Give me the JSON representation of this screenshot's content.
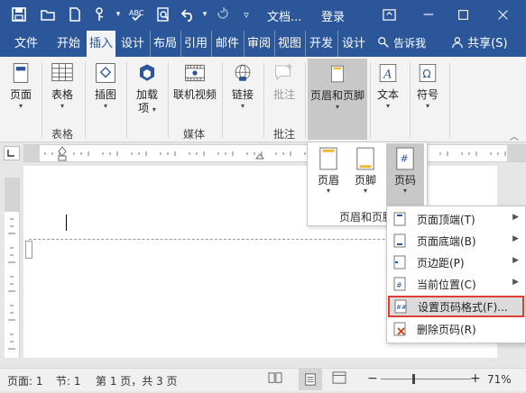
{
  "titlebar": {
    "title": "文档...",
    "signin": "登录",
    "colors": {
      "bg": "#2b579a"
    }
  },
  "tabs": [
    {
      "label": "文件"
    },
    {
      "label": "开始"
    },
    {
      "label": "插入",
      "active": true
    },
    {
      "label": "设计"
    },
    {
      "label": "布局"
    },
    {
      "label": "引用"
    },
    {
      "label": "邮件"
    },
    {
      "label": "审阅"
    },
    {
      "label": "视图"
    },
    {
      "label": "开发"
    },
    {
      "label": "设计"
    }
  ],
  "tellme": "告诉我",
  "share": "共享(S)",
  "ribbon": {
    "buttons": {
      "page": "页面",
      "table": "表格",
      "illus": "插图",
      "addin_1": "加载",
      "addin_2": "项",
      "video": "联机视频",
      "link": "链接",
      "comment": "批注",
      "headerfooter": "页眉和页脚",
      "text": "文本",
      "symbol": "符号"
    },
    "groups": {
      "table": "表格",
      "media": "媒体",
      "comments": "批注"
    }
  },
  "hf_panel": {
    "header": "页眉",
    "footer": "页脚",
    "pagenum": "页码",
    "group": "页眉和页脚"
  },
  "menu": {
    "items": [
      {
        "label": "页面顶端(T)",
        "submenu": true,
        "icon": "page-top-icon"
      },
      {
        "label": "页面底端(B)",
        "submenu": true,
        "icon": "page-bottom-icon"
      },
      {
        "label": "页边距(P)",
        "submenu": true,
        "icon": "page-margin-icon"
      },
      {
        "label": "当前位置(C)",
        "submenu": true,
        "icon": "current-position-icon"
      },
      {
        "label": "设置页码格式(F)...",
        "submenu": false,
        "icon": "format-page-number-icon",
        "highlighted": true
      },
      {
        "label": "删除页码(R)",
        "submenu": false,
        "icon": "delete-page-number-icon"
      }
    ],
    "highlight_color": "#e03c31"
  },
  "status": {
    "page": "页面: 1",
    "section": "节: 1",
    "pages": "第 1 页，共 3 页",
    "zoom": "71%"
  }
}
